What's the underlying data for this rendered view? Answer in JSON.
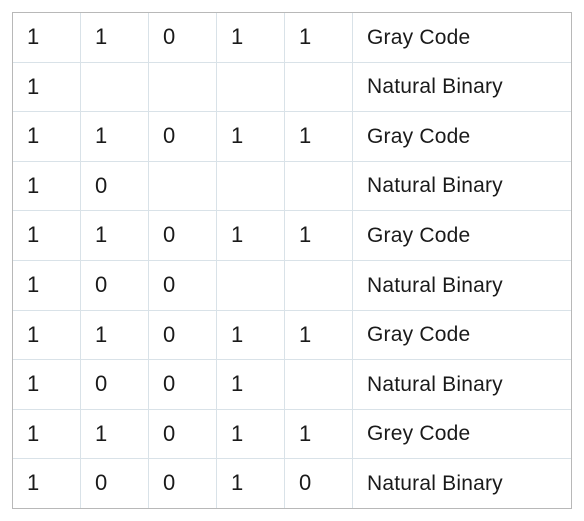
{
  "table": {
    "rows": [
      {
        "b0": "1",
        "b1": "1",
        "b2": "0",
        "b3": "1",
        "b4": "1",
        "label": "Gray Code"
      },
      {
        "b0": "1",
        "b1": "",
        "b2": "",
        "b3": "",
        "b4": "",
        "label": "Natural Binary"
      },
      {
        "b0": "1",
        "b1": "1",
        "b2": "0",
        "b3": "1",
        "b4": "1",
        "label": "Gray Code"
      },
      {
        "b0": "1",
        "b1": "0",
        "b2": "",
        "b3": "",
        "b4": "",
        "label": "Natural Binary"
      },
      {
        "b0": "1",
        "b1": "1",
        "b2": "0",
        "b3": "1",
        "b4": "1",
        "label": "Gray Code"
      },
      {
        "b0": "1",
        "b1": "0",
        "b2": "0",
        "b3": "",
        "b4": "",
        "label": "Natural Binary"
      },
      {
        "b0": "1",
        "b1": "1",
        "b2": "0",
        "b3": "1",
        "b4": "1",
        "label": "Gray Code"
      },
      {
        "b0": "1",
        "b1": "0",
        "b2": "0",
        "b3": "1",
        "b4": "",
        "label": "Natural Binary"
      },
      {
        "b0": "1",
        "b1": "1",
        "b2": "0",
        "b3": "1",
        "b4": "1",
        "label": "Grey Code"
      },
      {
        "b0": "1",
        "b1": "0",
        "b2": "0",
        "b3": "1",
        "b4": "0",
        "label": "Natural Binary"
      }
    ]
  }
}
